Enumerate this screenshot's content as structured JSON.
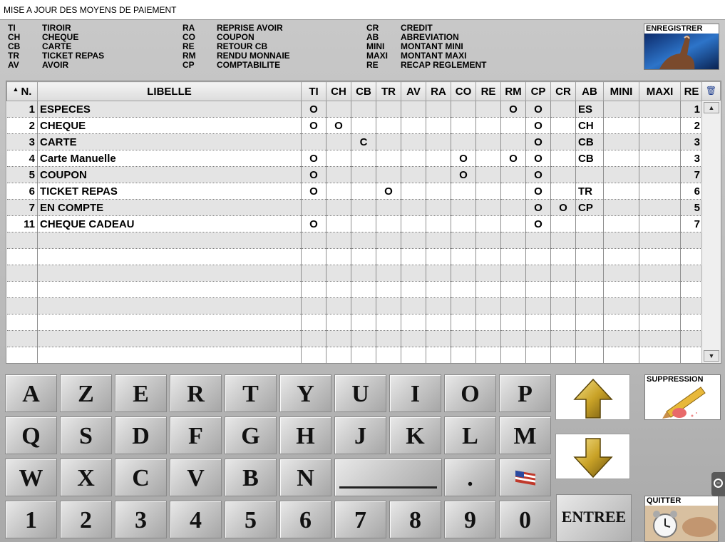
{
  "window": {
    "title": "MISE A JOUR DES MOYENS DE PAIEMENT"
  },
  "legend": [
    [
      {
        "code": "TI",
        "label": "TIROIR"
      },
      {
        "code": "CH",
        "label": "CHEQUE"
      },
      {
        "code": "CB",
        "label": "CARTE"
      },
      {
        "code": "TR",
        "label": "TICKET REPAS"
      },
      {
        "code": "AV",
        "label": "AVOIR"
      }
    ],
    [
      {
        "code": "RA",
        "label": "REPRISE AVOIR"
      },
      {
        "code": "CO",
        "label": "COUPON"
      },
      {
        "code": "RE",
        "label": "RETOUR CB"
      },
      {
        "code": "RM",
        "label": "RENDU MONNAIE"
      },
      {
        "code": "CP",
        "label": "COMPTABILITE"
      }
    ],
    [
      {
        "code": "CR",
        "label": "CREDIT"
      },
      {
        "code": "AB",
        "label": "ABREVIATION"
      },
      {
        "code": "MINI",
        "label": "MONTANT MINI"
      },
      {
        "code": "MAXI",
        "label": "MONTANT MAXI"
      },
      {
        "code": "RE",
        "label": "RECAP REGLEMENT"
      }
    ]
  ],
  "buttons": {
    "enregistrer": "ENREGISTRER",
    "suppression": "SUPPRESSION",
    "quitter": "QUITTER",
    "entree": "ENTREE"
  },
  "table": {
    "columns": [
      "N.",
      "LIBELLE",
      "TI",
      "CH",
      "CB",
      "TR",
      "AV",
      "RA",
      "CO",
      "RE",
      "RM",
      "CP",
      "CR",
      "AB",
      "MINI",
      "MAXI",
      "RE"
    ],
    "rows": [
      [
        "1",
        "ESPECES",
        "O",
        "",
        "",
        "",
        "",
        "",
        "",
        "",
        "O",
        "O",
        "",
        "ES",
        "",
        "",
        "1"
      ],
      [
        "2",
        "CHEQUE",
        "O",
        "O",
        "",
        "",
        "",
        "",
        "",
        "",
        "",
        "O",
        "",
        "CH",
        "",
        "",
        "2"
      ],
      [
        "3",
        "CARTE",
        "",
        "",
        "C",
        "",
        "",
        "",
        "",
        "",
        "",
        "O",
        "",
        "CB",
        "",
        "",
        "3"
      ],
      [
        "4",
        "Carte Manuelle",
        "O",
        "",
        "",
        "",
        "",
        "",
        "O",
        "",
        "O",
        "O",
        "",
        "CB",
        "",
        "",
        "3"
      ],
      [
        "5",
        "COUPON",
        "O",
        "",
        "",
        "",
        "",
        "",
        "O",
        "",
        "",
        "O",
        "",
        "",
        "",
        "",
        "7"
      ],
      [
        "6",
        "TICKET REPAS",
        "O",
        "",
        "",
        "O",
        "",
        "",
        "",
        "",
        "",
        "O",
        "",
        "TR",
        "",
        "",
        "6"
      ],
      [
        "7",
        "EN COMPTE",
        "",
        "",
        "",
        "",
        "",
        "",
        "",
        "",
        "",
        "O",
        "O",
        "CP",
        "",
        "",
        "5"
      ],
      [
        "11",
        "CHEQUE CADEAU",
        "O",
        "",
        "",
        "",
        "",
        "",
        "",
        "",
        "",
        "O",
        "",
        "",
        "",
        "",
        "7"
      ]
    ],
    "empty_rows": 8
  },
  "keyboard": {
    "row1": [
      "A",
      "Z",
      "E",
      "R",
      "T",
      "Y",
      "U",
      "I",
      "O",
      "P"
    ],
    "row2": [
      "Q",
      "S",
      "D",
      "F",
      "G",
      "H",
      "J",
      "K",
      "L",
      "M"
    ],
    "row3": [
      "W",
      "X",
      "C",
      "V",
      "B",
      "N"
    ],
    "row3_dot": ".",
    "row4": [
      "1",
      "2",
      "3",
      "4",
      "5",
      "6",
      "7",
      "8",
      "9",
      "0"
    ]
  },
  "icons": {
    "sort": "sort-up-icon",
    "delete_column": "trash-icon",
    "up": "arrow-up-icon",
    "down": "arrow-down-icon",
    "flag": "flag-icon",
    "collapse": "minus-circle-icon"
  },
  "colors": {
    "accent_gold": "#c9a227",
    "row_alt": "#e4e4e4"
  }
}
